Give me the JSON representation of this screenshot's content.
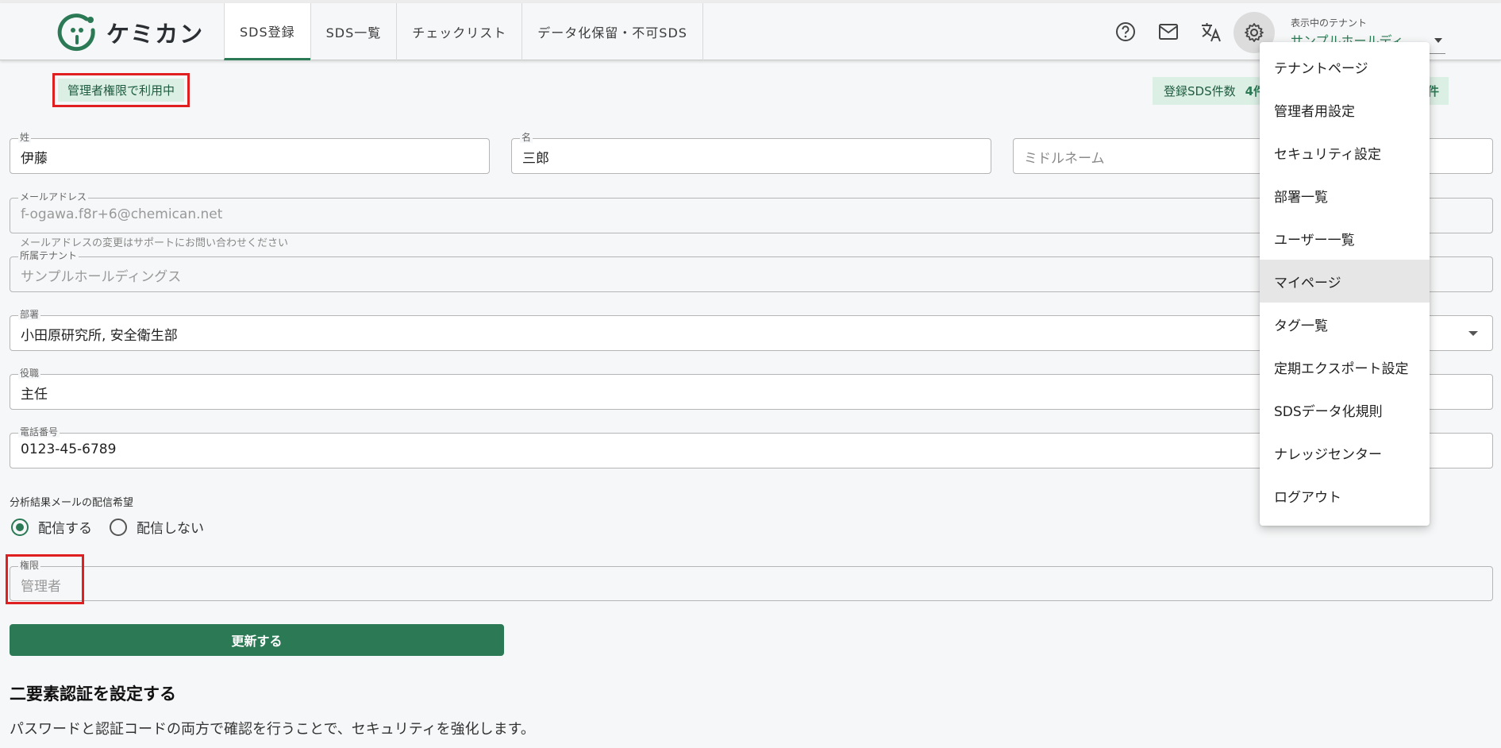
{
  "header": {
    "logo_text": "ケミカン",
    "tabs": [
      {
        "label": "SDS登録",
        "active": true
      },
      {
        "label": "SDS一覧",
        "active": false
      },
      {
        "label": "チェックリスト",
        "active": false
      },
      {
        "label": "データ化保留・不可SDS",
        "active": false
      }
    ],
    "icons": [
      "help-icon",
      "mail-icon",
      "translate-icon",
      "gear-icon"
    ],
    "tenant_caption": "表示中のテナント",
    "tenant_value": "サンプルホールディ"
  },
  "badges": {
    "admin": "管理者権限で利用中",
    "count_label": "登録SDS件数",
    "count_value": "4件",
    "count_tail": "件"
  },
  "form": {
    "last_name": {
      "label": "姓",
      "value": "伊藤"
    },
    "first_name": {
      "label": "名",
      "value": "三郎"
    },
    "middle_name": {
      "placeholder": "ミドルネーム"
    },
    "email": {
      "label": "メールアドレス",
      "value": "f-ogawa.f8r+6@chemican.net",
      "helper": "メールアドレスの変更はサポートにお問い合わせください"
    },
    "tenant": {
      "label": "所属テナント",
      "value": "サンプルホールディングス"
    },
    "department": {
      "label": "部署",
      "value": "小田原研究所, 安全衛生部"
    },
    "position": {
      "label": "役職",
      "value": "主任"
    },
    "phone": {
      "label": "電話番号",
      "value": "0123-45-6789"
    },
    "mail_pref": {
      "label": "分析結果メールの配信希望",
      "options": [
        {
          "label": "配信する",
          "checked": true
        },
        {
          "label": "配信しない",
          "checked": false
        }
      ]
    },
    "permission": {
      "label": "権限",
      "value": "管理者"
    },
    "submit_label": "更新する"
  },
  "two_factor": {
    "heading": "二要素認証を設定する",
    "description": "パスワードと認証コードの両方で確認を行うことで、セキュリティを強化します。"
  },
  "menu": {
    "items": [
      {
        "label": "テナントページ",
        "selected": false
      },
      {
        "label": "管理者用設定",
        "selected": false
      },
      {
        "label": "セキュリティ設定",
        "selected": false
      },
      {
        "label": "部署一覧",
        "selected": false
      },
      {
        "label": "ユーザー一覧",
        "selected": false
      },
      {
        "label": "マイページ",
        "selected": true
      },
      {
        "label": "タグ一覧",
        "selected": false
      },
      {
        "label": "定期エクスポート設定",
        "selected": false
      },
      {
        "label": "SDSデータ化規則",
        "selected": false
      },
      {
        "label": "ナレッジセンター",
        "selected": false
      },
      {
        "label": "ログアウト",
        "selected": false
      }
    ]
  },
  "colors": {
    "accent": "#2c7a55",
    "badge_bg": "#dcefe5",
    "highlight_red": "#e02020"
  }
}
